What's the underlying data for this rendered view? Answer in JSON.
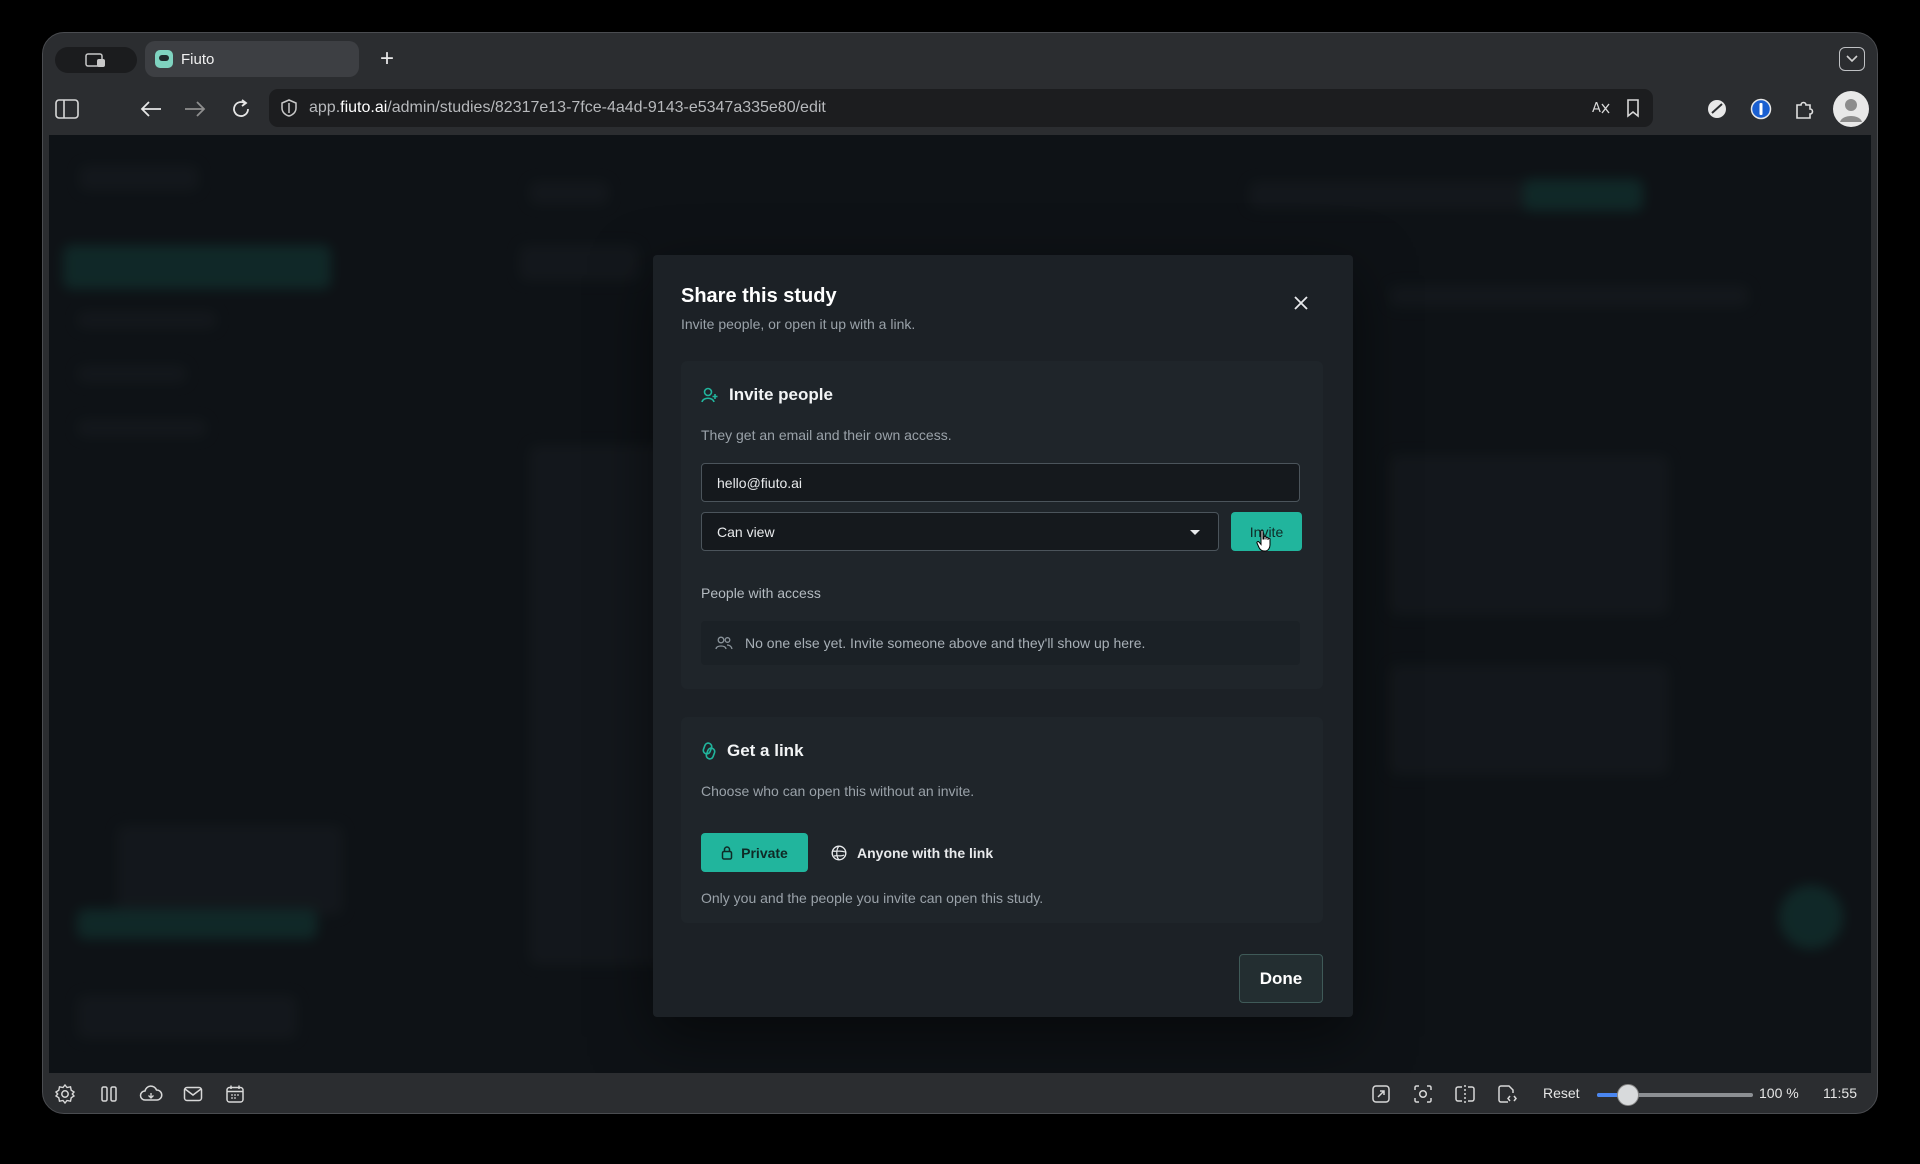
{
  "browser": {
    "tab_title": "Fiuto",
    "url_prefix": "app.",
    "url_domain": "fiuto.ai",
    "url_path": "/admin/studies/82317e13-7fce-4a4d-9143-e5347a335e80/edit"
  },
  "modal": {
    "title": "Share this study",
    "subtitle": "Invite people, or open it up with a link.",
    "invite": {
      "heading": "Invite people",
      "description": "They get an email and their own access.",
      "email_value": "hello@fiuto.ai",
      "role_selected": "Can view",
      "invite_label": "Invite",
      "people_label": "People with access",
      "empty_text": "No one else yet. Invite someone above and they'll show up here."
    },
    "link": {
      "heading": "Get a link",
      "description": "Choose who can open this without an invite.",
      "private_label": "Private",
      "anyone_label": "Anyone with the link",
      "note": "Only you and the people you invite can open this study."
    },
    "done_label": "Done"
  },
  "statusbar": {
    "reset_label": "Reset",
    "zoom_level": "100 %",
    "zoom_fraction": 0.2,
    "clock": "11:55"
  },
  "colors": {
    "accent": "#21b59d",
    "zoom_accent": "#4a86f0"
  }
}
